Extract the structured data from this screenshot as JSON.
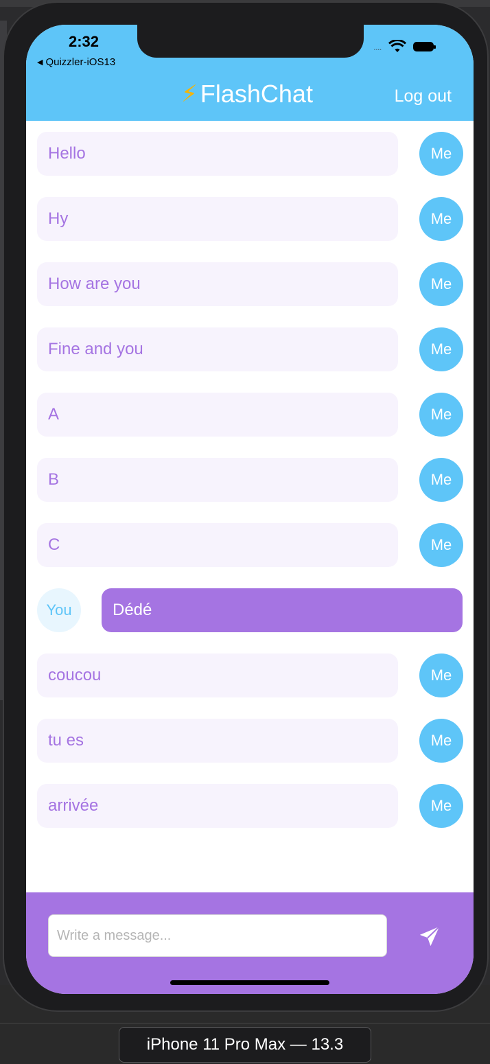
{
  "status_bar": {
    "time": "2:32",
    "back_app": "Quizzler-iOS13",
    "signal": "....",
    "wifi_icon": "wifi-icon",
    "battery_icon": "battery-icon"
  },
  "header": {
    "title": "FlashChat",
    "logo_icon": "lightning-icon",
    "logout_label": "Log out"
  },
  "messages": [
    {
      "sender": "Me",
      "text": "Hello"
    },
    {
      "sender": "Me",
      "text": "Hy"
    },
    {
      "sender": "Me",
      "text": "How are you"
    },
    {
      "sender": "Me",
      "text": "Fine and you"
    },
    {
      "sender": "Me",
      "text": "A"
    },
    {
      "sender": "Me",
      "text": "B"
    },
    {
      "sender": "Me",
      "text": "C"
    },
    {
      "sender": "You",
      "text": "Dédé"
    },
    {
      "sender": "Me",
      "text": "coucou"
    },
    {
      "sender": "Me",
      "text": "tu es"
    },
    {
      "sender": "Me",
      "text": "arrivée"
    }
  ],
  "composer": {
    "placeholder": "Write a message...",
    "value": "",
    "send_icon": "paper-plane-icon"
  },
  "device_label": "iPhone 11 Pro Max — 13.3",
  "colors": {
    "header": "#5ec5f8",
    "accent_purple": "#a574e2",
    "bubble_light": "#f7f3fd",
    "avatar_you_bg": "#e8f6fe"
  }
}
